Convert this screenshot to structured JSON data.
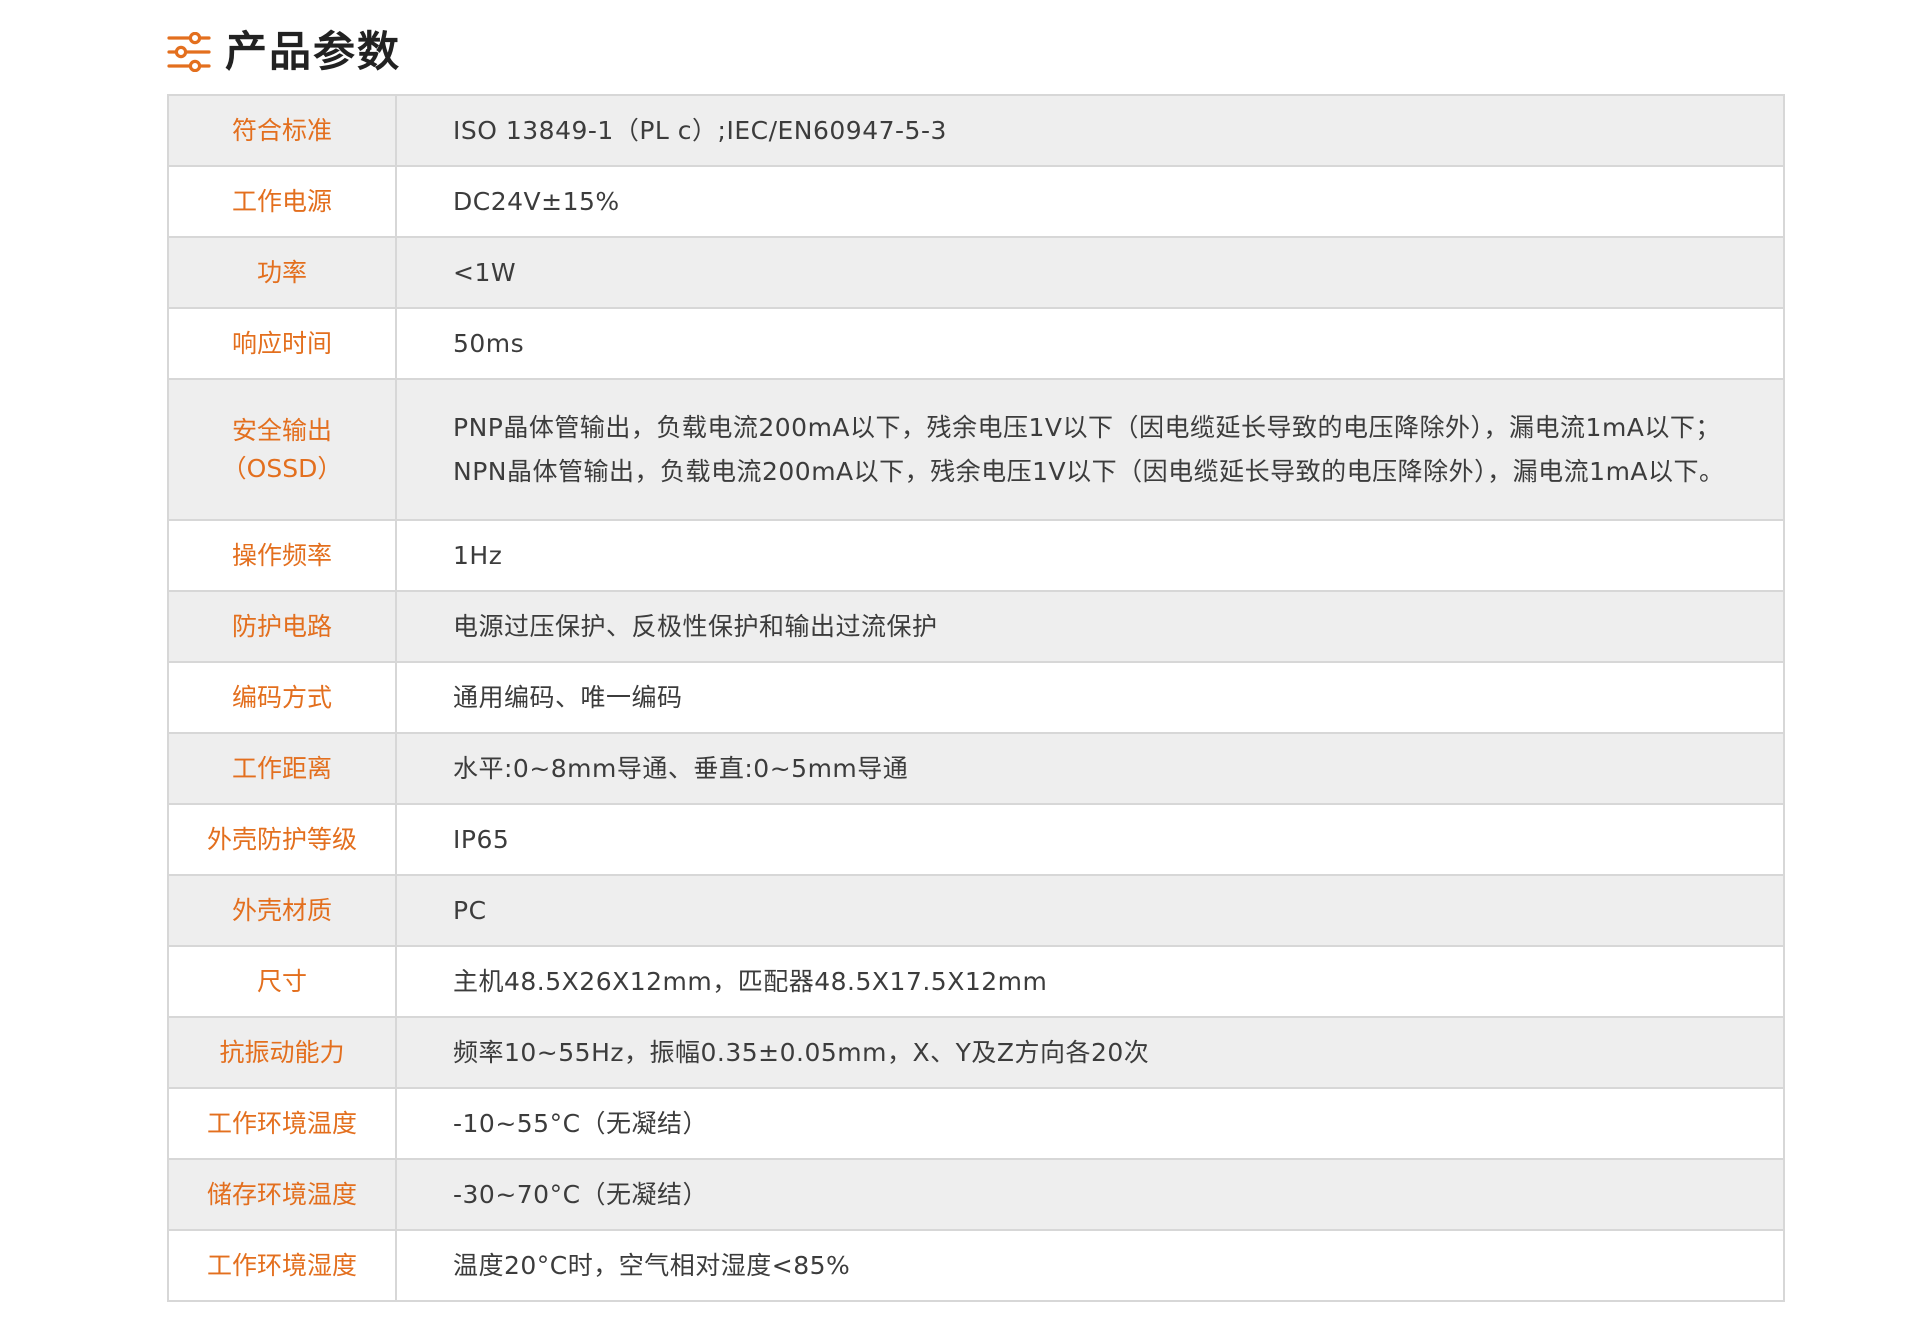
{
  "header": {
    "title": "产品参数",
    "icon": "sliders-icon",
    "accent_color": "#e36f1e"
  },
  "rows": [
    {
      "label": "符合标准",
      "value": [
        "ISO 13849-1（PL c）;IEC/EN60947-5-3"
      ]
    },
    {
      "label": "工作电源",
      "value": [
        "DC24V±15%"
      ]
    },
    {
      "label": "功率",
      "value": [
        "<1W"
      ]
    },
    {
      "label": "响应时间",
      "value": [
        "50ms"
      ]
    },
    {
      "label": "安全输出\n（OSSD）",
      "value": [
        "PNP晶体管输出，负载电流200mA以下，残余电压1V以下（因电缆延长导致的电压降除外），漏电流1mA以下；",
        "NPN晶体管输出，负载电流200mA以下，残余电压1V以下（因电缆延长导致的电压降除外），漏电流1mA以下。"
      ]
    },
    {
      "label": "操作频率",
      "value": [
        "1Hz"
      ]
    },
    {
      "label": "防护电路",
      "value": [
        "电源过压保护、反极性保护和输出过流保护"
      ]
    },
    {
      "label": "编码方式",
      "value": [
        "通用编码、唯一编码"
      ]
    },
    {
      "label": "工作距离",
      "value": [
        "水平:0~8mm导通、垂直:0~5mm导通"
      ]
    },
    {
      "label": "外壳防护等级",
      "value": [
        "IP65"
      ]
    },
    {
      "label": "外壳材质",
      "value": [
        "PC"
      ]
    },
    {
      "label": "尺寸",
      "value": [
        "主机48.5X26X12mm，匹配器48.5X17.5X12mm"
      ]
    },
    {
      "label": "抗振动能力",
      "value": [
        "频率10~55Hz，振幅0.35±0.05mm，X、Y及Z方向各20次"
      ]
    },
    {
      "label": "工作环境温度",
      "value": [
        "-10~55°C（无凝结）"
      ]
    },
    {
      "label": "储存环境温度",
      "value": [
        "-30~70°C（无凝结）"
      ]
    },
    {
      "label": "工作环境湿度",
      "value": [
        "温度20°C时，空气相对湿度<85%"
      ]
    }
  ]
}
